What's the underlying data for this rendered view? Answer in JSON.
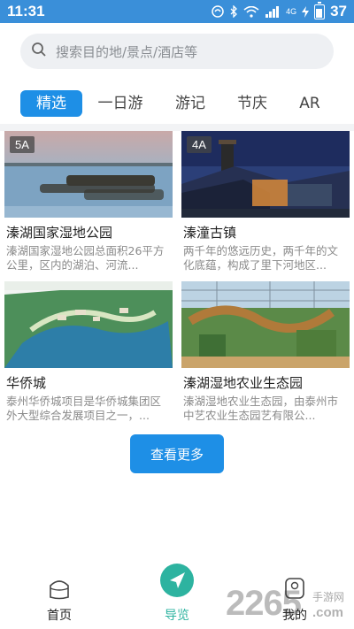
{
  "status_bar": {
    "time": "11:31",
    "network": "4G",
    "battery": "37"
  },
  "search": {
    "placeholder": "搜索目的地/景点/酒店等"
  },
  "tabs": [
    {
      "label": "精选",
      "active": true
    },
    {
      "label": "一日游",
      "active": false
    },
    {
      "label": "游记",
      "active": false
    },
    {
      "label": "节庆",
      "active": false
    },
    {
      "label": "AR",
      "active": false
    }
  ],
  "cards": [
    {
      "badge": "5A",
      "title": "溱湖国家湿地公园",
      "desc": "溱湖国家湿地公园总面积26平方公里，区内的湖泊、河流..."
    },
    {
      "badge": "4A",
      "title": "溱潼古镇",
      "desc": "两千年的悠远历史，两千年的文化底蕴，构成了里下河地区..."
    },
    {
      "badge": "",
      "title": "华侨城",
      "desc": "泰州华侨城项目是华侨城集团区外大型综合发展项目之一，..."
    },
    {
      "badge": "",
      "title": "溱湖湿地农业生态园",
      "desc": "溱湖湿地农业生态园，由泰州市中艺农业生态园艺有限公..."
    }
  ],
  "more_button": "查看更多",
  "bottom_nav": [
    {
      "label": "首页",
      "icon": "home-icon"
    },
    {
      "label": "导览",
      "icon": "navigation-icon"
    },
    {
      "label": "我的",
      "icon": "profile-icon"
    }
  ],
  "watermark": {
    "brand": "2265",
    "sub": "手游网",
    "url": ".com"
  },
  "colors": {
    "status_bar": "#3a8fd9",
    "accent": "#1e8fe6",
    "nav_active": "#2db3a0"
  }
}
